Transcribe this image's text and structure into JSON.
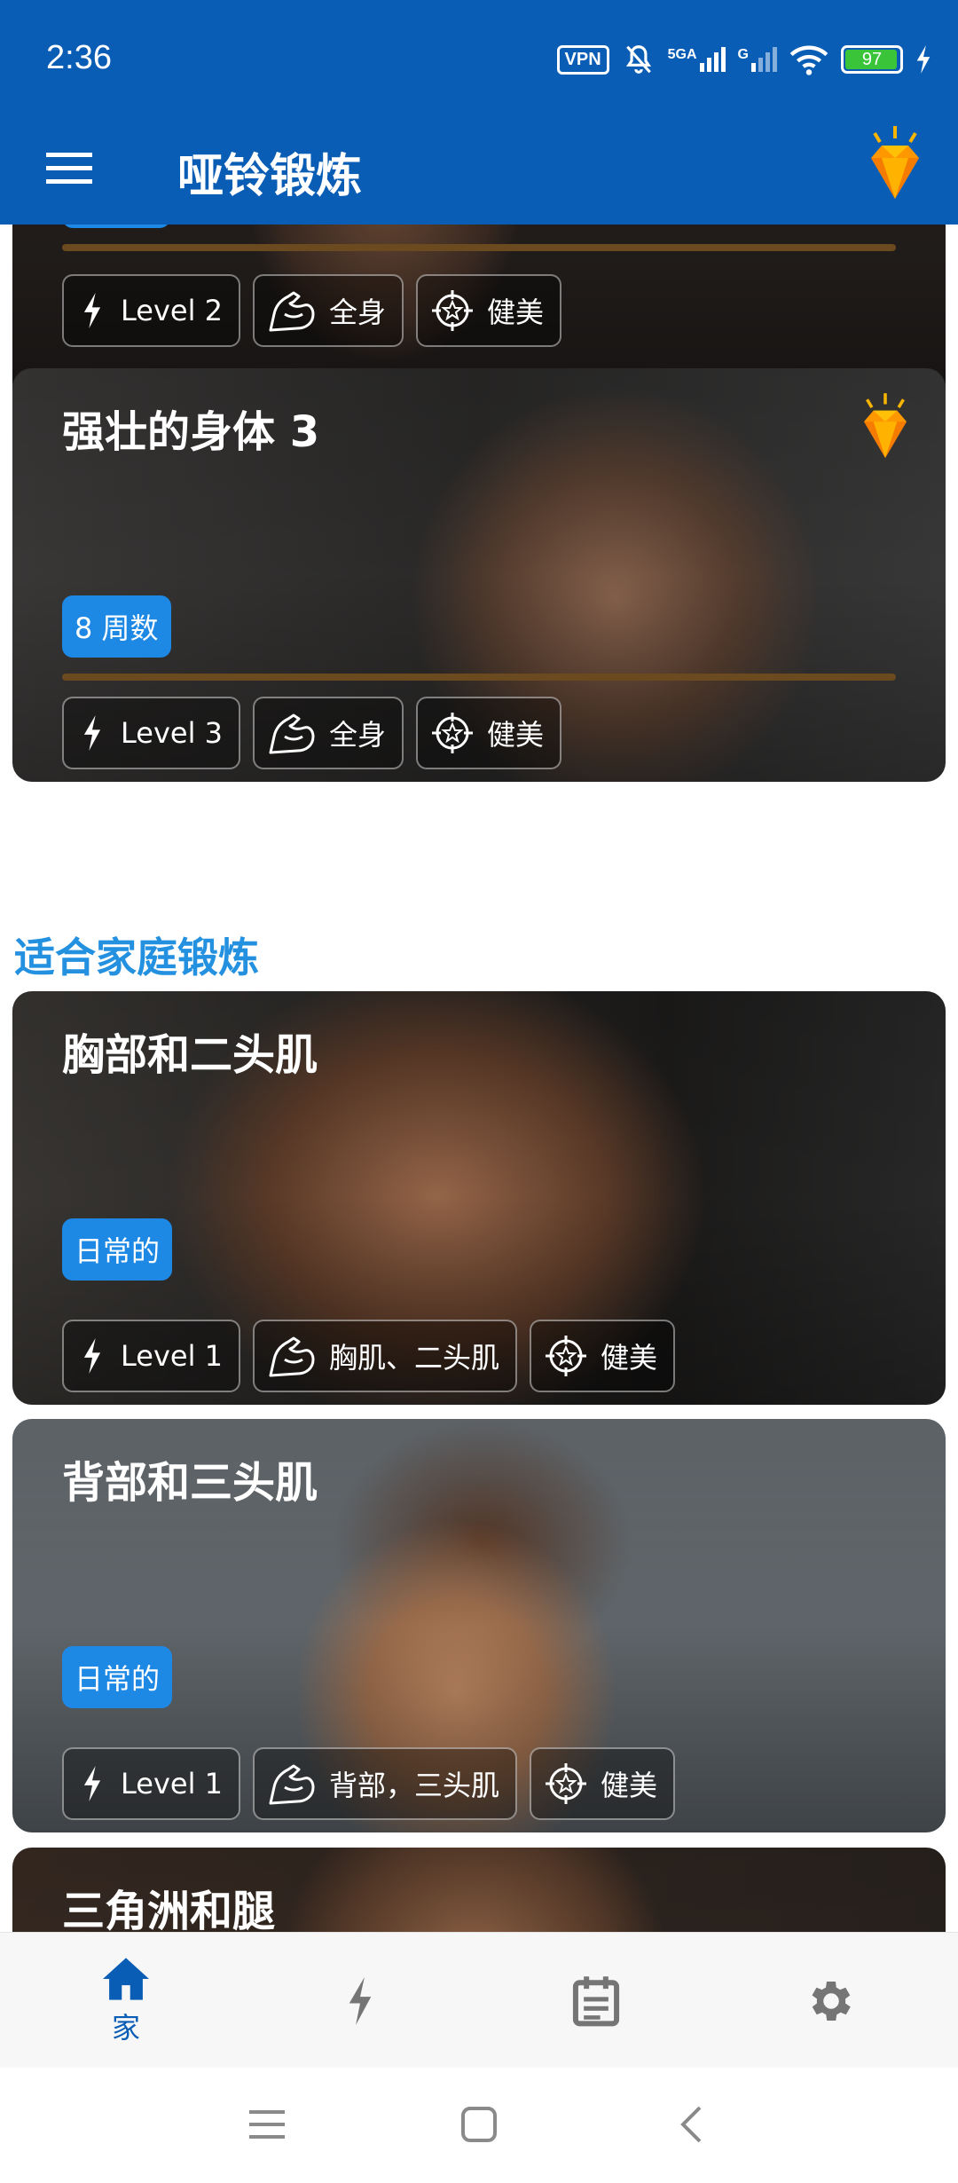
{
  "status_bar": {
    "time": "2:36",
    "vpn_label": "VPN",
    "network_label": "5GA",
    "network2_label": "G",
    "battery_level": "97"
  },
  "toolbar": {
    "title": "哑铃锻炼"
  },
  "cards": [
    {
      "title": "",
      "badge": "",
      "level": "Level 2",
      "muscle": "全身",
      "goal": "健美"
    },
    {
      "title": "强壮的身体 3",
      "badge": "8 周数",
      "level": "Level 3",
      "muscle": "全身",
      "goal": "健美"
    },
    {
      "title": "胸部和二头肌",
      "badge": "日常的",
      "level": "Level 1",
      "muscle": "胸肌、二头肌",
      "goal": "健美"
    },
    {
      "title": "背部和三头肌",
      "badge": "日常的",
      "level": "Level 1",
      "muscle": "背部，三头肌",
      "goal": "健美"
    },
    {
      "title": "三角洲和腿"
    }
  ],
  "section": {
    "home_workout_title": "适合家庭锻炼"
  },
  "bottom_nav": {
    "home_label": "家"
  },
  "colors": {
    "primary": "#0a5db5",
    "accent": "#1e88e5",
    "section_title": "#2390e0"
  },
  "icons": [
    "menu-icon",
    "premium-diamond-icon",
    "lightning-icon",
    "bicep-icon",
    "target-icon",
    "home-icon",
    "calendar-icon",
    "gear-icon"
  ]
}
